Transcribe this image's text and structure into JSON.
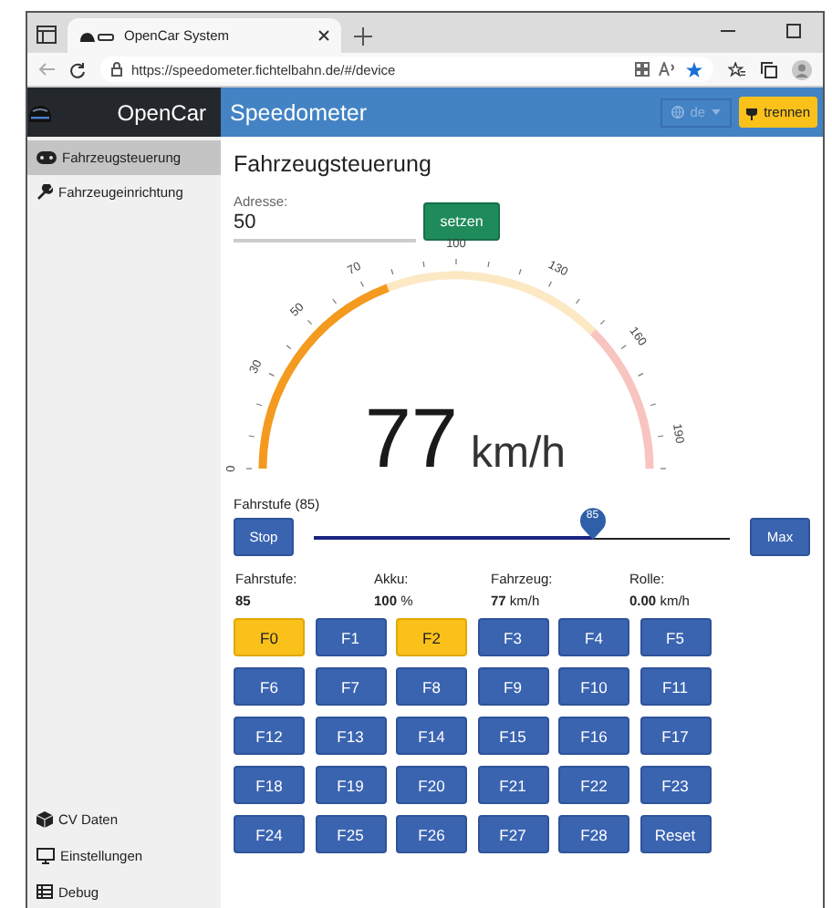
{
  "browser": {
    "tab_title": "OpenCar System",
    "url": "https://speedometer.fichtelbahn.de/#/device"
  },
  "header": {
    "brand": "OpenCar",
    "page_title": "Speedometer",
    "language": "de",
    "disconnect": "trennen"
  },
  "sidebar": {
    "items": [
      {
        "label": "Fahrzeugsteuerung",
        "selected": true
      },
      {
        "label": "Fahrzeugeinrichtung",
        "selected": false
      }
    ],
    "bottom_items": [
      {
        "label": "CV Daten",
        "selected": false
      },
      {
        "label": "Einstellungen",
        "selected": false
      },
      {
        "label": "Debug",
        "selected": false
      }
    ]
  },
  "content": {
    "title": "Fahrzeugsteuerung",
    "address": {
      "label": "Adresse:",
      "value": "50",
      "button": "setzen"
    },
    "gauge": {
      "value": "77",
      "unit": "km/h",
      "ticks": [
        {
          "label": "0"
        },
        {
          "label": "30"
        },
        {
          "label": "50"
        },
        {
          "label": "70"
        },
        {
          "label": "100"
        },
        {
          "label": "130"
        },
        {
          "label": "160"
        },
        {
          "label": "190"
        }
      ]
    },
    "slider": {
      "label": "Fahrstufe (85)",
      "stop": "Stop",
      "max": "Max",
      "bubble": "85",
      "level": 0.67
    },
    "stats": [
      {
        "label": "Fahrstufe:",
        "value": "85"
      },
      {
        "label": "Akku:",
        "value": "100",
        "unit": "%"
      },
      {
        "label": "Fahrzeug:",
        "value": "77",
        "unit": "km/h"
      },
      {
        "label": "Rolle:",
        "value": "0.00",
        "unit": "km/h"
      }
    ],
    "functions": [
      {
        "label": "F0",
        "selected": true
      },
      {
        "label": "F1",
        "selected": false
      },
      {
        "label": "F2",
        "selected": true
      },
      {
        "label": "F3",
        "selected": false
      },
      {
        "label": "F4",
        "selected": false
      },
      {
        "label": "F5",
        "selected": false
      },
      {
        "label": "F6",
        "selected": false
      },
      {
        "label": "F7",
        "selected": false
      },
      {
        "label": "F8",
        "selected": false
      },
      {
        "label": "F9",
        "selected": false
      },
      {
        "label": "F10",
        "selected": false
      },
      {
        "label": "F11",
        "selected": false
      },
      {
        "label": "F12",
        "selected": false
      },
      {
        "label": "F13",
        "selected": false
      },
      {
        "label": "F14",
        "selected": false
      },
      {
        "label": "F15",
        "selected": false
      },
      {
        "label": "F16",
        "selected": false
      },
      {
        "label": "F17",
        "selected": false
      },
      {
        "label": "F18",
        "selected": false
      },
      {
        "label": "F19",
        "selected": false
      },
      {
        "label": "F20",
        "selected": false
      },
      {
        "label": "F21",
        "selected": false
      },
      {
        "label": "F22",
        "selected": false
      },
      {
        "label": "F23",
        "selected": false
      },
      {
        "label": "F24",
        "selected": false
      },
      {
        "label": "F25",
        "selected": false
      },
      {
        "label": "F26",
        "selected": false
      },
      {
        "label": "F27",
        "selected": false
      },
      {
        "label": "F28",
        "selected": false
      },
      {
        "label": "Reset",
        "selected": false
      }
    ]
  }
}
